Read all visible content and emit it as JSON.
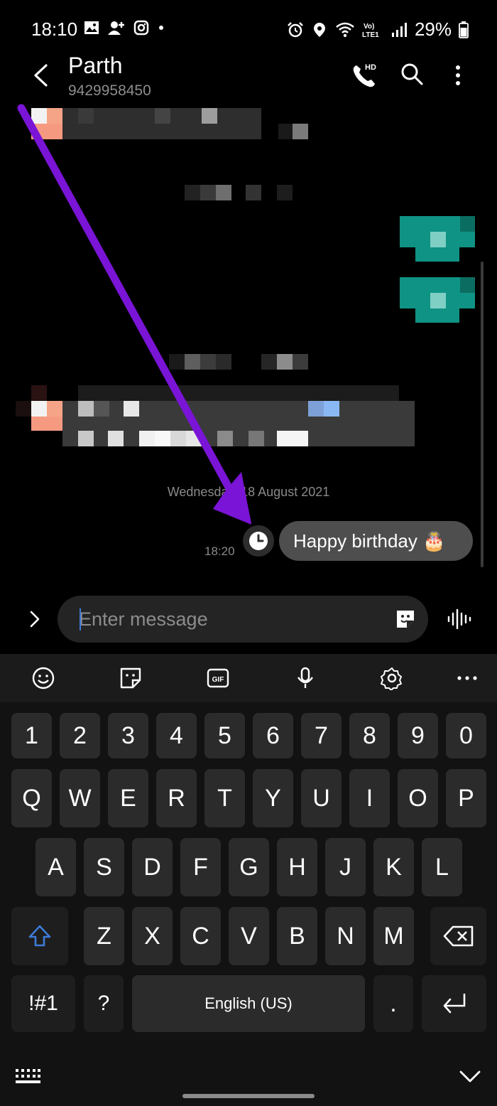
{
  "status_bar": {
    "time": "18:10",
    "battery": "29%",
    "left_icons": [
      "image-icon",
      "contact-add-icon",
      "instagram-icon",
      "dot-icon"
    ],
    "right_icons": [
      "alarm-icon",
      "location-icon",
      "wifi-icon",
      "volte-icon",
      "signal-icon",
      "battery-icon"
    ]
  },
  "header": {
    "contact_name": "Parth",
    "contact_number": "9429958450",
    "call_badge": "HD"
  },
  "conversation": {
    "date_separator": "Wednesday, 18 August 2021",
    "scheduled_message": {
      "time": "18:20",
      "text": "Happy birthday 🎂"
    }
  },
  "composer": {
    "placeholder": "Enter message"
  },
  "keyboard": {
    "toolbar": [
      "emoji-icon",
      "sticker-icon",
      "gif-icon",
      "mic-icon",
      "settings-icon",
      "more-icon"
    ],
    "gif_label": "GIF",
    "row_numbers": [
      "1",
      "2",
      "3",
      "4",
      "5",
      "6",
      "7",
      "8",
      "9",
      "0"
    ],
    "row_top": [
      "Q",
      "W",
      "E",
      "R",
      "T",
      "Y",
      "U",
      "I",
      "O",
      "P"
    ],
    "row_home": [
      "A",
      "S",
      "D",
      "F",
      "G",
      "H",
      "J",
      "K",
      "L"
    ],
    "row_bottom": [
      "Z",
      "X",
      "C",
      "V",
      "B",
      "N",
      "M"
    ],
    "symbols_key": "!#1",
    "question_key": "?",
    "space_key": "English (US)",
    "period_key": "."
  },
  "colors": {
    "annotation_arrow": "#7a14d6",
    "accent_blue": "#3d7bd8",
    "bubble": "#4e4e4e"
  }
}
